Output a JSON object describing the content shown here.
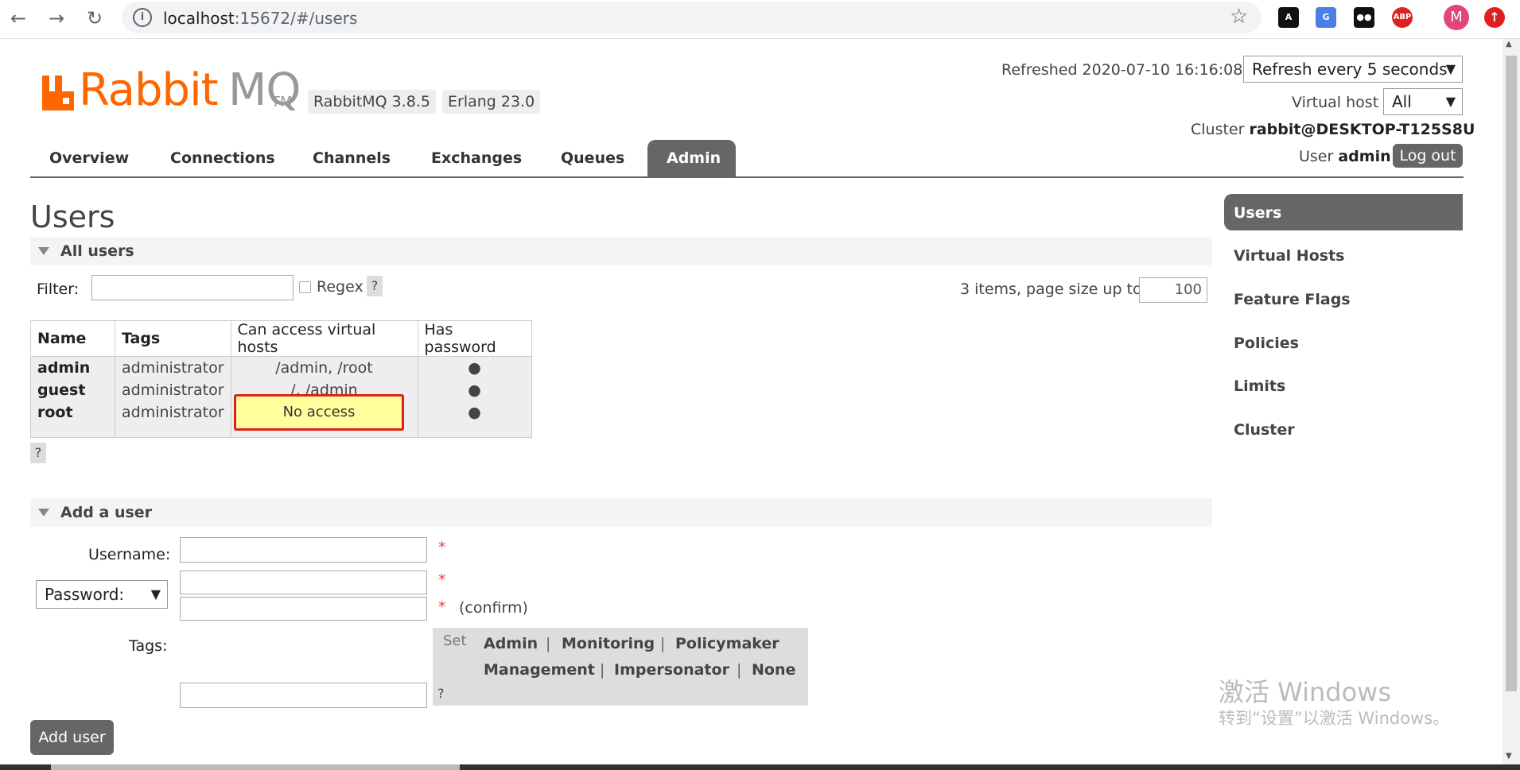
{
  "browser": {
    "url_host": "localhost",
    "url_rest": ":15672/#/users",
    "profile_initial": "M"
  },
  "header": {
    "logo_main": "Rabbit",
    "logo_mq": "MQ",
    "logo_tm": "TM",
    "rabbitmq_version": "RabbitMQ 3.8.5",
    "erlang_version": "Erlang 23.0",
    "refreshed_label": "Refreshed 2020-07-10 16:16:08",
    "refresh_select": "Refresh every 5 seconds",
    "vhost_label": "Virtual host",
    "vhost_select": "All",
    "cluster_label": "Cluster",
    "cluster_name": "rabbit@DESKTOP-T125S8U",
    "user_label": "User",
    "user_name": "admin",
    "logout_label": "Log out"
  },
  "tabs": [
    "Overview",
    "Connections",
    "Channels",
    "Exchanges",
    "Queues",
    "Admin"
  ],
  "active_tab": "Admin",
  "right_nav": [
    "Users",
    "Virtual Hosts",
    "Feature Flags",
    "Policies",
    "Limits",
    "Cluster"
  ],
  "page_title": "Users",
  "all_users": {
    "section_title": "All users",
    "filter_label": "Filter:",
    "regex_label": "Regex",
    "help": "?",
    "items_label": "3 items, page size up to",
    "page_size": "100",
    "columns": [
      "Name",
      "Tags",
      "Can access virtual hosts",
      "Has password"
    ],
    "rows": [
      {
        "name": "admin",
        "tags": "administrator",
        "vhosts": "/admin, /root",
        "has_password": "●"
      },
      {
        "name": "guest",
        "tags": "administrator",
        "vhosts": "/, /admin",
        "has_password": "●"
      },
      {
        "name": "root",
        "tags": "administrator",
        "vhosts": "No access",
        "has_password": "●"
      }
    ]
  },
  "add_user": {
    "section_title": "Add a user",
    "username_label": "Username:",
    "password_select": "Password:",
    "required_mark": "*",
    "confirm_label": "(confirm)",
    "tags_label": "Tags:",
    "set_label": "Set",
    "tag_options": [
      "Admin",
      "Monitoring",
      "Policymaker",
      "Management",
      "Impersonator",
      "None"
    ],
    "separator": "|",
    "help": "?",
    "submit_label": "Add user"
  },
  "watermark": {
    "line1": "激活 Windows",
    "line2": "转到“设置”以激活 Windows。"
  },
  "colors": {
    "brand_orange": "#ff6600",
    "tab_active": "#666666",
    "highlight_fill": "#ffff9e",
    "highlight_border": "#e02020"
  }
}
